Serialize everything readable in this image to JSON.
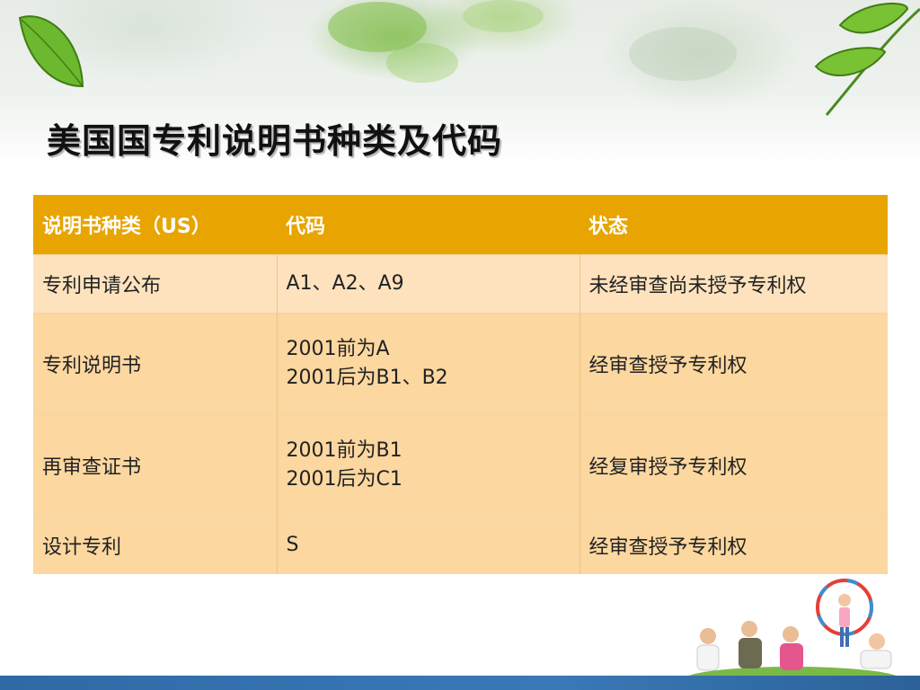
{
  "slide": {
    "title": "美国国专利说明书种类及代码"
  },
  "table": {
    "headers": [
      "说明书种类（US）",
      "代码",
      "状态"
    ],
    "rows": [
      {
        "type": "专利申请公布",
        "codes": [
          "A1、A2、A9"
        ],
        "status": "未经审查尚未授予专利权"
      },
      {
        "type": "专利说明书",
        "codes": [
          "2001前为A",
          "2001后为B1、B2"
        ],
        "status": "经审查授予专利权"
      },
      {
        "type": "再审查证书",
        "codes": [
          "2001前为B1",
          "2001后为C1"
        ],
        "status": "经复审授予专利权"
      },
      {
        "type": "设计专利",
        "codes": [
          "S"
        ],
        "status": "经审查授予专利权"
      }
    ]
  },
  "colors": {
    "header_bg": "#e8a400",
    "row_bg_light": "#fde2bd",
    "row_bg": "#fcd7a0",
    "footer_band": "#3a79b7",
    "leaf_green": "#6cb82e"
  }
}
